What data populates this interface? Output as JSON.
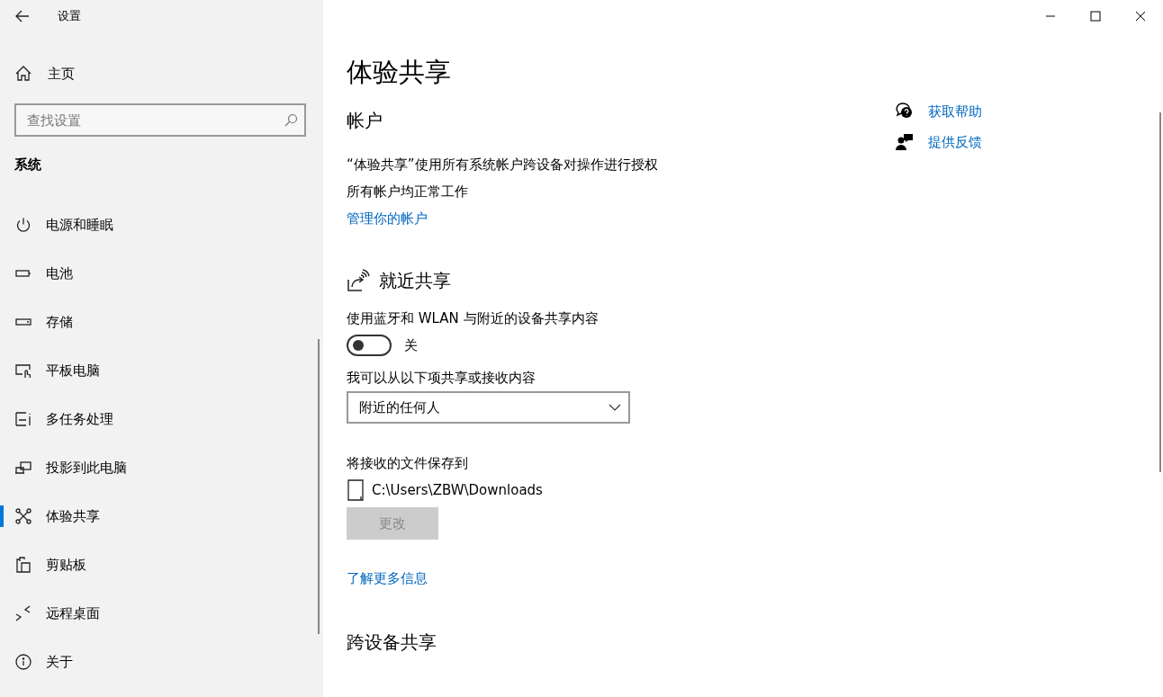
{
  "window": {
    "title": "设置"
  },
  "sidebar": {
    "home": "主页",
    "search": {
      "placeholder": "查找设置"
    },
    "section": "系统",
    "items": [
      {
        "label": "电源和睡眠",
        "selected": false
      },
      {
        "label": "电池",
        "selected": false
      },
      {
        "label": "存储",
        "selected": false
      },
      {
        "label": "平板电脑",
        "selected": false
      },
      {
        "label": "多任务处理",
        "selected": false
      },
      {
        "label": "投影到此电脑",
        "selected": false
      },
      {
        "label": "体验共享",
        "selected": true
      },
      {
        "label": "剪贴板",
        "selected": false
      },
      {
        "label": "远程桌面",
        "selected": false
      },
      {
        "label": "关于",
        "selected": false
      }
    ]
  },
  "page": {
    "title": "体验共享",
    "account": {
      "heading": "帐户",
      "lines": [
        "“体验共享”使用所有系统帐户跨设备对操作进行授权",
        "所有帐户均正常工作"
      ],
      "link": "管理你的帐户"
    },
    "nearby": {
      "heading": "就近共享",
      "description": "使用蓝牙和 WLAN 与附近的设备共享内容",
      "toggle": {
        "on": false,
        "label": "关"
      },
      "share_label": "我可以从以下项共享或接收内容",
      "dropdown": {
        "value": "附近的任何人"
      },
      "save_label": "将接收的文件保存到",
      "path": "C:\\Users\\ZBW\\Downloads",
      "change_button": {
        "label": "更改",
        "disabled": true
      },
      "link": "了解更多信息"
    },
    "cross_device": {
      "heading": "跨设备共享"
    }
  },
  "related": [
    {
      "label": "获取帮助"
    },
    {
      "label": "提供反馈"
    }
  ]
}
